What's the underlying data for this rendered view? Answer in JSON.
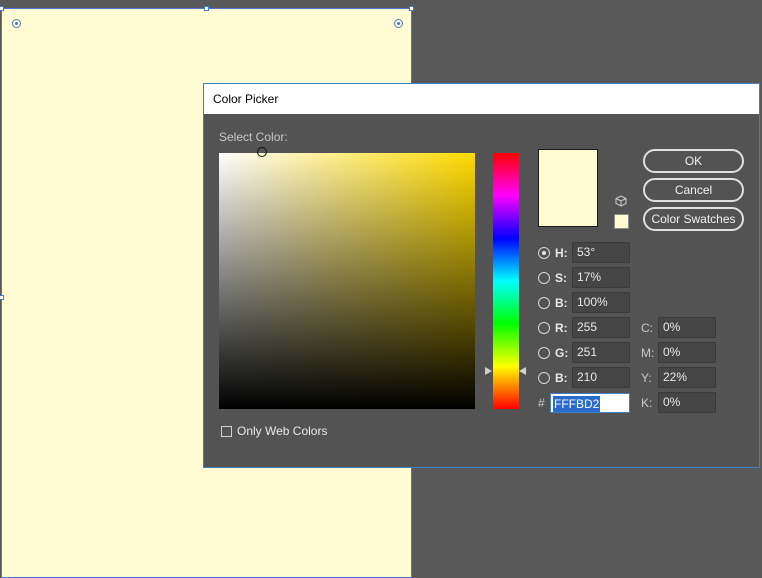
{
  "dialog": {
    "title": "Color Picker",
    "select_color_label": "Select Color:",
    "only_web_colors_label": "Only Web Colors",
    "only_web_colors_checked": false,
    "buttons": {
      "ok": "OK",
      "cancel": "Cancel",
      "swatches": "Color Swatches"
    },
    "current_color": "#fffbd2",
    "hsb": {
      "h": {
        "label": "H:",
        "value": "53°",
        "selected": true
      },
      "s": {
        "label": "S:",
        "value": "17%",
        "selected": false
      },
      "b": {
        "label": "B:",
        "value": "100%",
        "selected": false
      }
    },
    "rgb": {
      "r": {
        "label": "R:",
        "value": "255"
      },
      "g": {
        "label": "G:",
        "value": "251"
      },
      "b": {
        "label": "B:",
        "value": "210"
      }
    },
    "cmyk": {
      "c": {
        "label": "C:",
        "value": "0%"
      },
      "m": {
        "label": "M:",
        "value": "0%"
      },
      "y": {
        "label": "Y:",
        "value": "22%"
      },
      "k": {
        "label": "K:",
        "value": "0%"
      }
    },
    "hex": {
      "prefix": "#",
      "value": "FFFBD2"
    }
  },
  "icons": {
    "gamut_warning": "cube-icon"
  },
  "colors": {
    "fill": "#fffbd2",
    "selection": "#4a78d0",
    "dialog_bg": "#535353"
  }
}
